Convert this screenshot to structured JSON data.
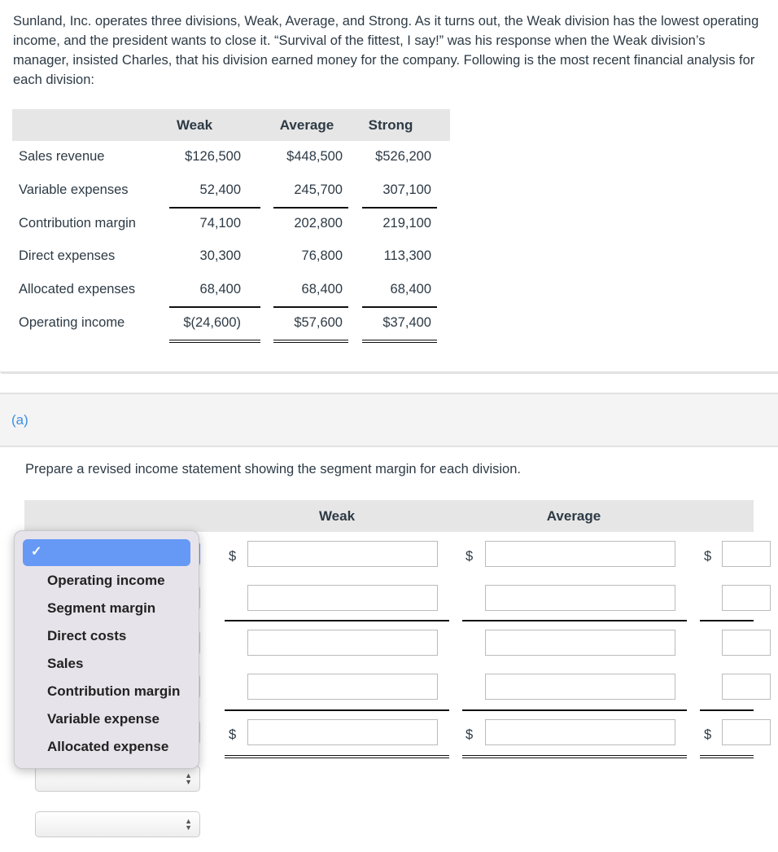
{
  "intro": "Sunland, Inc. operates three divisions, Weak, Average, and Strong. As it turns out, the Weak division has the lowest operating income, and the president wants to close it. “Survival of the fittest, I say!” was his response when the Weak division’s manager, insisted Charles, that his division earned money for the company. Following is the most recent financial analysis for each division:",
  "table1": {
    "headers": [
      "Weak",
      "Average",
      "Strong"
    ],
    "rows": [
      {
        "label": "Sales revenue",
        "values": [
          "$126,500",
          "$448,500",
          "$526,200"
        ]
      },
      {
        "label": "Variable expenses",
        "values": [
          "52,400",
          "245,700",
          "307,100"
        ]
      },
      {
        "label": "Contribution margin",
        "values": [
          "74,100",
          "202,800",
          "219,100"
        ]
      },
      {
        "label": "Direct expenses",
        "values": [
          "30,300",
          "76,800",
          "113,300"
        ]
      },
      {
        "label": "Allocated expenses",
        "values": [
          "68,400",
          "68,400",
          "68,400"
        ]
      },
      {
        "label": "Operating income",
        "values": [
          "$(24,600)",
          "$57,600",
          "$37,400"
        ]
      }
    ]
  },
  "part": {
    "label": "(a)",
    "instruction": "Prepare a revised income statement showing the segment margin for each division."
  },
  "table2": {
    "headers": [
      "Weak",
      "Average"
    ],
    "currency": "$"
  },
  "dropdown": {
    "selected_mark": "✓",
    "options": [
      "Operating income",
      "Segment margin",
      "Direct costs",
      "Sales",
      "Contribution margin",
      "Variable expense",
      "Allocated expense"
    ]
  }
}
